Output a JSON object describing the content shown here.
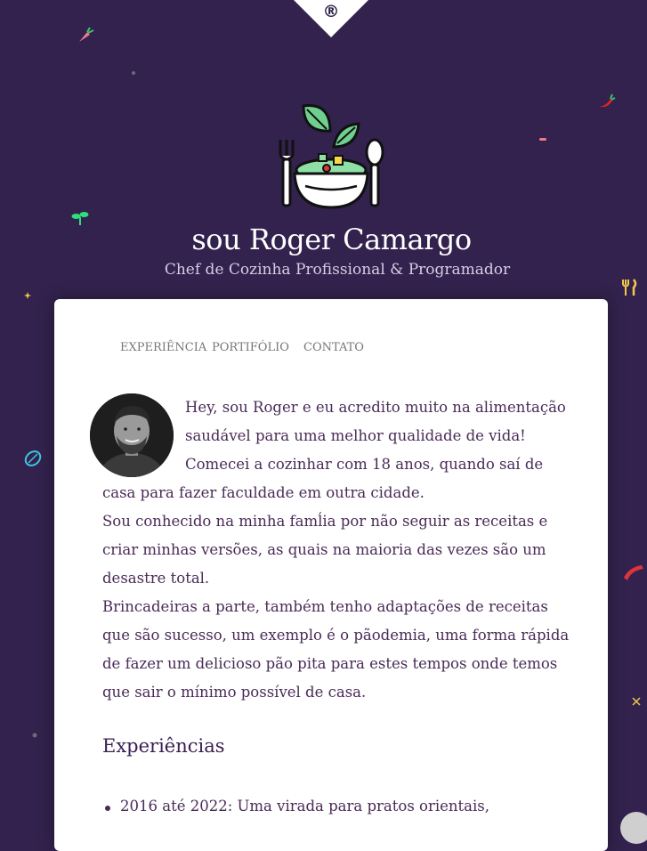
{
  "colors": {
    "background": "#32224d",
    "card": "#ffffff",
    "text": "#4a2b57",
    "heading": "#3a1e52",
    "nav_text": "#777777"
  },
  "badge": {
    "mark": "®"
  },
  "header": {
    "title": "sou Roger Camargo",
    "subtitle": "Chef de Cozinha Profissional & Programador",
    "logo_icon": "salad-bowl-icon"
  },
  "nav": {
    "items": [
      {
        "label": "EXPERIÊNCIA"
      },
      {
        "label": "PORTIFÓLIO"
      },
      {
        "label": "CONTATO"
      }
    ]
  },
  "intro": {
    "paragraphs": [
      "Hey, sou Roger e eu acredito muito na alimentação saudável para uma melhor qualidade de vida! Comecei a cozinhar com 18 anos, quando saí de casa para fazer faculdade em outra cidade.",
      "Sou conhecido na minha famĺia por não seguir as receitas e criar minhas versões, as quais na maioria das vezes são um desastre total.",
      "Brincadeiras a parte, também tenho adaptações de receitas que são sucesso, um exemplo é o pãodemia, uma forma rápida de fazer um delicioso pão pita para estes tempos onde temos que sair o mínimo possível de casa."
    ]
  },
  "experiences": {
    "heading": "Experiências",
    "items": [
      "2016 até 2022: Uma virada para pratos orientais,"
    ]
  },
  "decorations": [
    "carrot-icon",
    "chili-pepper-icon",
    "sprout-icon",
    "cutlery-icon",
    "lime-icon",
    "bacon-icon",
    "sparkle-icon"
  ]
}
